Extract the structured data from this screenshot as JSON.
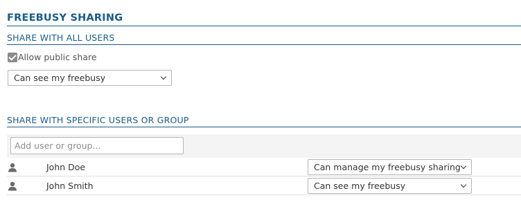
{
  "page": {
    "title": "FREEBUSY SHARING"
  },
  "share_all": {
    "heading": "SHARE WITH ALL USERS",
    "allow_public_label": "Allow public share",
    "allow_public_checked": true,
    "permission": "Can see my freebusy"
  },
  "share_specific": {
    "heading": "SHARE WITH SPECIFIC USERS OR GROUP",
    "add_placeholder": "Add user or group...",
    "users": [
      {
        "icon": "user-icon",
        "name": "John Doe",
        "permission": "Can manage my freebusy sharing"
      },
      {
        "icon": "user-icon",
        "name": "John Smith",
        "permission": "Can see my freebusy"
      }
    ]
  },
  "colors": {
    "heading": "#1b5c87",
    "checkbox": "#8a8a8a",
    "band": "#f4f4f4"
  }
}
